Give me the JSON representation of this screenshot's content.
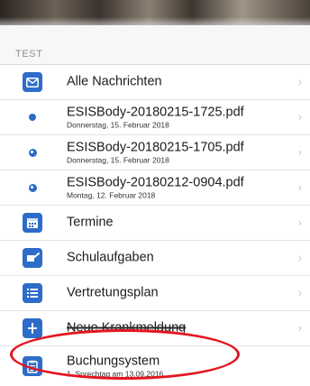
{
  "section": {
    "title": "TEST"
  },
  "rows": [
    {
      "label": "Alle Nachrichten",
      "sublabel": "",
      "icon": "envelope-icon"
    },
    {
      "label": "ESISBody-20180215-1725.pdf",
      "sublabel": "Donnerstag, 15. Februar 2018",
      "icon": "unread-dot-icon"
    },
    {
      "label": "ESISBody-20180215-1705.pdf",
      "sublabel": "Donnerstag, 15. Februar 2018",
      "icon": "read-dot-icon"
    },
    {
      "label": "ESISBody-20180212-0904.pdf",
      "sublabel": "Montag, 12. Februar 2018",
      "icon": "read-dot-icon"
    },
    {
      "label": "Termine",
      "sublabel": "",
      "icon": "calendar-icon"
    },
    {
      "label": "Schulaufgaben",
      "sublabel": "",
      "icon": "homework-icon"
    },
    {
      "label": "Vertretungsplan",
      "sublabel": "",
      "icon": "list-icon"
    },
    {
      "label": "Neue Krankmeldung",
      "sublabel": "",
      "icon": "medical-icon"
    },
    {
      "label": "Buchungsystem",
      "sublabel": "1. Sprechtag am 13.09.2016",
      "icon": "clipboard-icon"
    }
  ],
  "chevron": "›",
  "colors": {
    "accent": "#2d6cc9",
    "annotation": "#e4151f",
    "background": "#efeff4"
  }
}
